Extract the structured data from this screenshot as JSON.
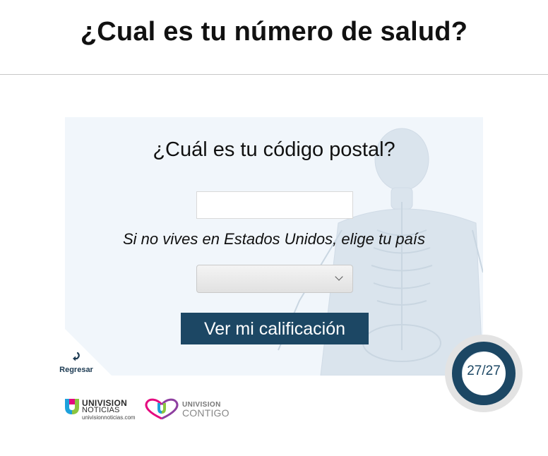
{
  "header": {
    "title": "¿Cual es tu número de salud?"
  },
  "form": {
    "question": "¿Cuál es tu código postal?",
    "zip_value": "",
    "country_hint": "Si no vives en Estados Unidos, elige tu país",
    "country_selected": "",
    "submit_label": "Ver mi calificación"
  },
  "nav": {
    "back_label": "Regresar",
    "back_icon": "return-arrow-icon"
  },
  "progress": {
    "current": 27,
    "total": 27,
    "text": "27/27",
    "fraction": 1.0,
    "ring_color": "#1c4764",
    "track_color": "#e3e3e3"
  },
  "logos": {
    "noticias": {
      "brand": "UNIVISION",
      "sub": "NOTICIAS",
      "url": "univisionnoticias.com"
    },
    "contigo": {
      "brand": "UNIVISION",
      "sub": "CONTIGO"
    }
  },
  "colors": {
    "accent": "#1c4764",
    "card_background": "#f1f6fb"
  }
}
